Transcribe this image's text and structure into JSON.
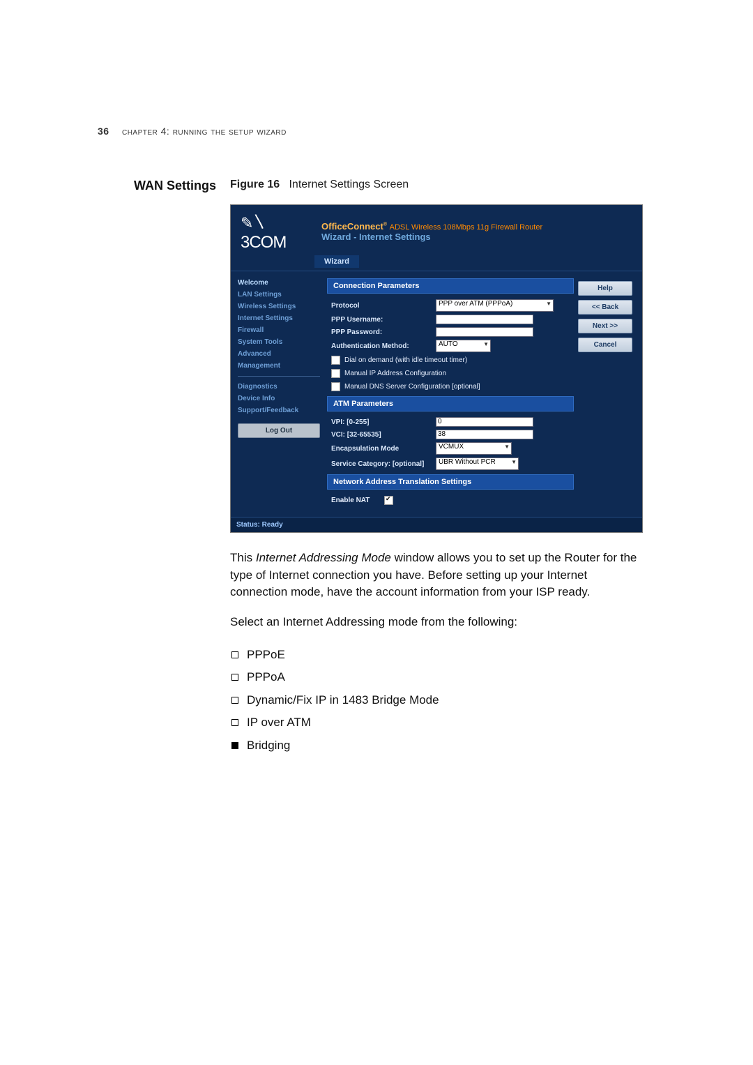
{
  "page": {
    "number": "36",
    "running_head": "Chapter 4: Running the Setup Wizard",
    "section_heading": "WAN Settings",
    "figure_label": "Figure 16",
    "figure_caption": "Internet Settings Screen"
  },
  "screenshot": {
    "logo_icon": "✎〵",
    "brand": "3COM",
    "product_bold": "OfficeConnect",
    "product_rest": "ADSL Wireless 108Mbps 11g Firewall Router",
    "subtitle": "Wizard - Internet Settings",
    "tab": "Wizard",
    "nav": {
      "items": [
        "Welcome",
        "LAN Settings",
        "Wireless Settings",
        "Internet Settings",
        "Firewall",
        "System Tools",
        "Advanced",
        "Management"
      ],
      "items2": [
        "Diagnostics",
        "Device Info",
        "Support/Feedback"
      ],
      "logout": "Log Out",
      "active": "Welcome"
    },
    "buttons": {
      "help": "Help",
      "back": "<< Back",
      "next": "Next >>",
      "cancel": "Cancel"
    },
    "conn": {
      "heading": "Connection Parameters",
      "protocol_label": "Protocol",
      "protocol_value": "PPP over ATM (PPPoA)",
      "user_label": "PPP Username:",
      "user_value": "",
      "pass_label": "PPP Password:",
      "pass_value": "",
      "auth_label": "Authentication Method:",
      "auth_value": "AUTO",
      "dial_label": "Dial on demand (with idle timeout timer)",
      "manual_ip_label": "Manual IP Address Configuration",
      "manual_dns_label": "Manual DNS Server Configuration [optional]"
    },
    "atm": {
      "heading": "ATM Parameters",
      "vpi_label": "VPI: [0-255]",
      "vpi_value": "0",
      "vci_label": "VCI: [32-65535]",
      "vci_value": "38",
      "encap_label": "Encapsulation Mode",
      "encap_value": "VCMUX",
      "svc_label": "Service Category:  [optional]",
      "svc_value": "UBR Without PCR"
    },
    "nat": {
      "heading": "Network Address Translation Settings",
      "enable_label": "Enable NAT",
      "enable_checked": true
    },
    "status": "Status: Ready"
  },
  "body": {
    "para1a": "This ",
    "para1_em": "Internet Addressing Mode",
    "para1b": " window allows you to set up the Router for the type of Internet connection you have. Before setting up your Internet connection mode, have the account information from your ISP ready.",
    "para2": "Select an Internet Addressing mode from the following:",
    "bullets": [
      "PPPoE",
      "PPPoA",
      "Dynamic/Fix IP in 1483 Bridge Mode",
      "IP over ATM",
      "Bridging"
    ]
  }
}
